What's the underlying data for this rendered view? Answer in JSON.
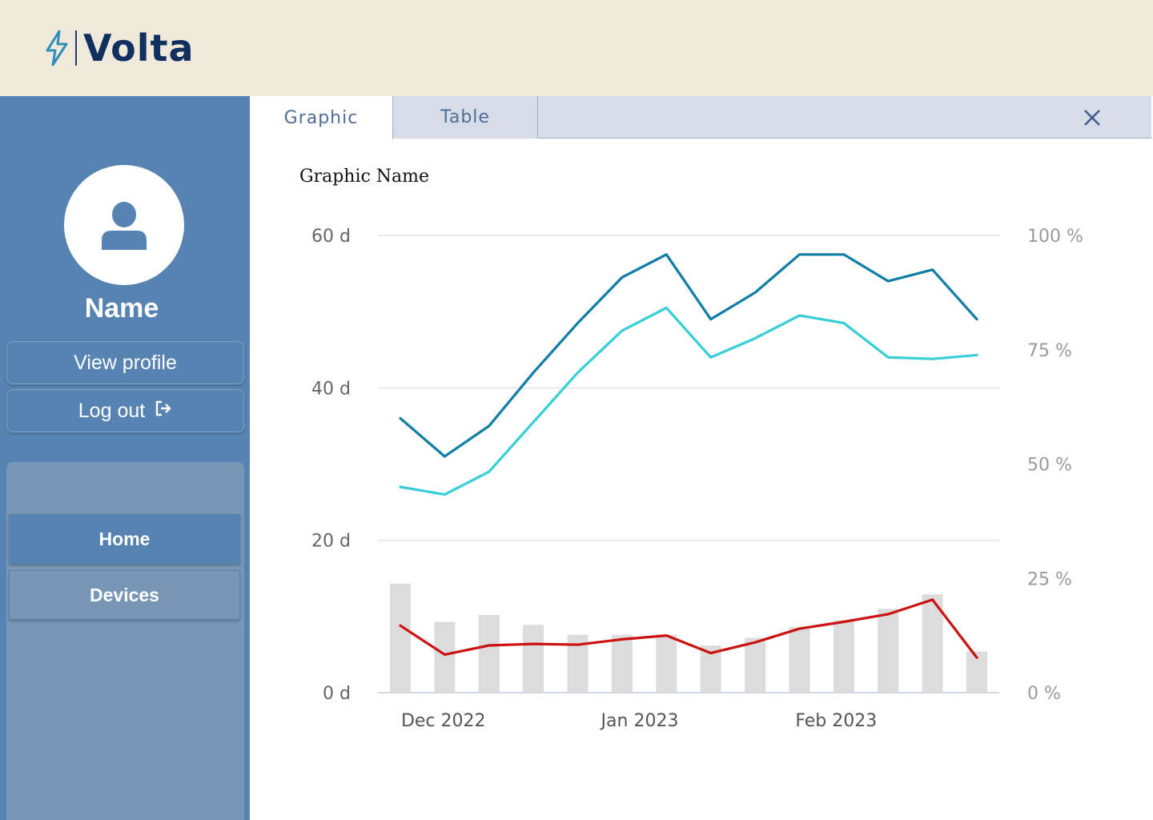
{
  "brand": {
    "name": "Volta",
    "icon": "lightning-bolt-icon",
    "color": "#12305f",
    "icon_color": "#2e8fb8"
  },
  "user": {
    "name": "Name",
    "avatar_icon": "person-icon"
  },
  "sidebar": {
    "view_profile_label": "View profile",
    "logout_label": "Log out",
    "logout_icon": "logout-icon",
    "menu": [
      {
        "label": "Home",
        "active": true
      },
      {
        "label": "Devices",
        "active": false
      }
    ]
  },
  "tabs": [
    {
      "label": "Graphic",
      "active": true
    },
    {
      "label": "Table",
      "active": false
    }
  ],
  "close_icon": "close-icon",
  "chart_data": {
    "type": "line",
    "title": "Graphic Name",
    "x_ticks": [
      "Dec 2022",
      "Jan 2023",
      "Feb 2023"
    ],
    "x": [
      "2022-11-28",
      "2022-12-05",
      "2022-12-12",
      "2022-12-19",
      "2022-12-26",
      "2023-01-02",
      "2023-01-09",
      "2023-01-16",
      "2023-01-23",
      "2023-01-30",
      "2023-02-06",
      "2023-02-13",
      "2023-02-20",
      "2023-02-27"
    ],
    "y_left": {
      "ticks": [
        "0 d",
        "20 d",
        "40 d",
        "60 d"
      ],
      "ylim": [
        0,
        60
      ],
      "unit": "d"
    },
    "y_right": {
      "ticks": [
        "0 %",
        "25 %",
        "50 %",
        "75 %",
        "100 %"
      ],
      "ylim": [
        0,
        100
      ],
      "unit": "%"
    },
    "series": [
      {
        "type": "line",
        "axis": "left",
        "color": "#0e7ea6",
        "values": [
          36,
          31,
          35,
          42,
          48.5,
          54.5,
          57.5,
          49,
          52.5,
          57.5,
          57.5,
          54,
          55.5,
          49
        ]
      },
      {
        "type": "line",
        "axis": "left",
        "color": "#36cfd6",
        "values": [
          27,
          26,
          29,
          35.5,
          42,
          47.5,
          50.5,
          44,
          46.5,
          49.5,
          48.5,
          44,
          43.8,
          44.3
        ]
      },
      {
        "type": "bar",
        "axis": "left",
        "color": "#dcdcdc",
        "values": [
          14.3,
          9.3,
          10.2,
          8.9,
          7.6,
          7.6,
          7.6,
          6.2,
          7.2,
          8.6,
          9.5,
          11,
          12.9,
          5.4
        ]
      },
      {
        "type": "line",
        "axis": "left",
        "color": "#cc1111",
        "values": [
          8.8,
          5,
          6.2,
          6.4,
          6.3,
          7,
          7.5,
          5.2,
          6.6,
          8.4,
          9.3,
          10.3,
          12.2,
          4.6
        ]
      }
    ],
    "grid": true
  }
}
